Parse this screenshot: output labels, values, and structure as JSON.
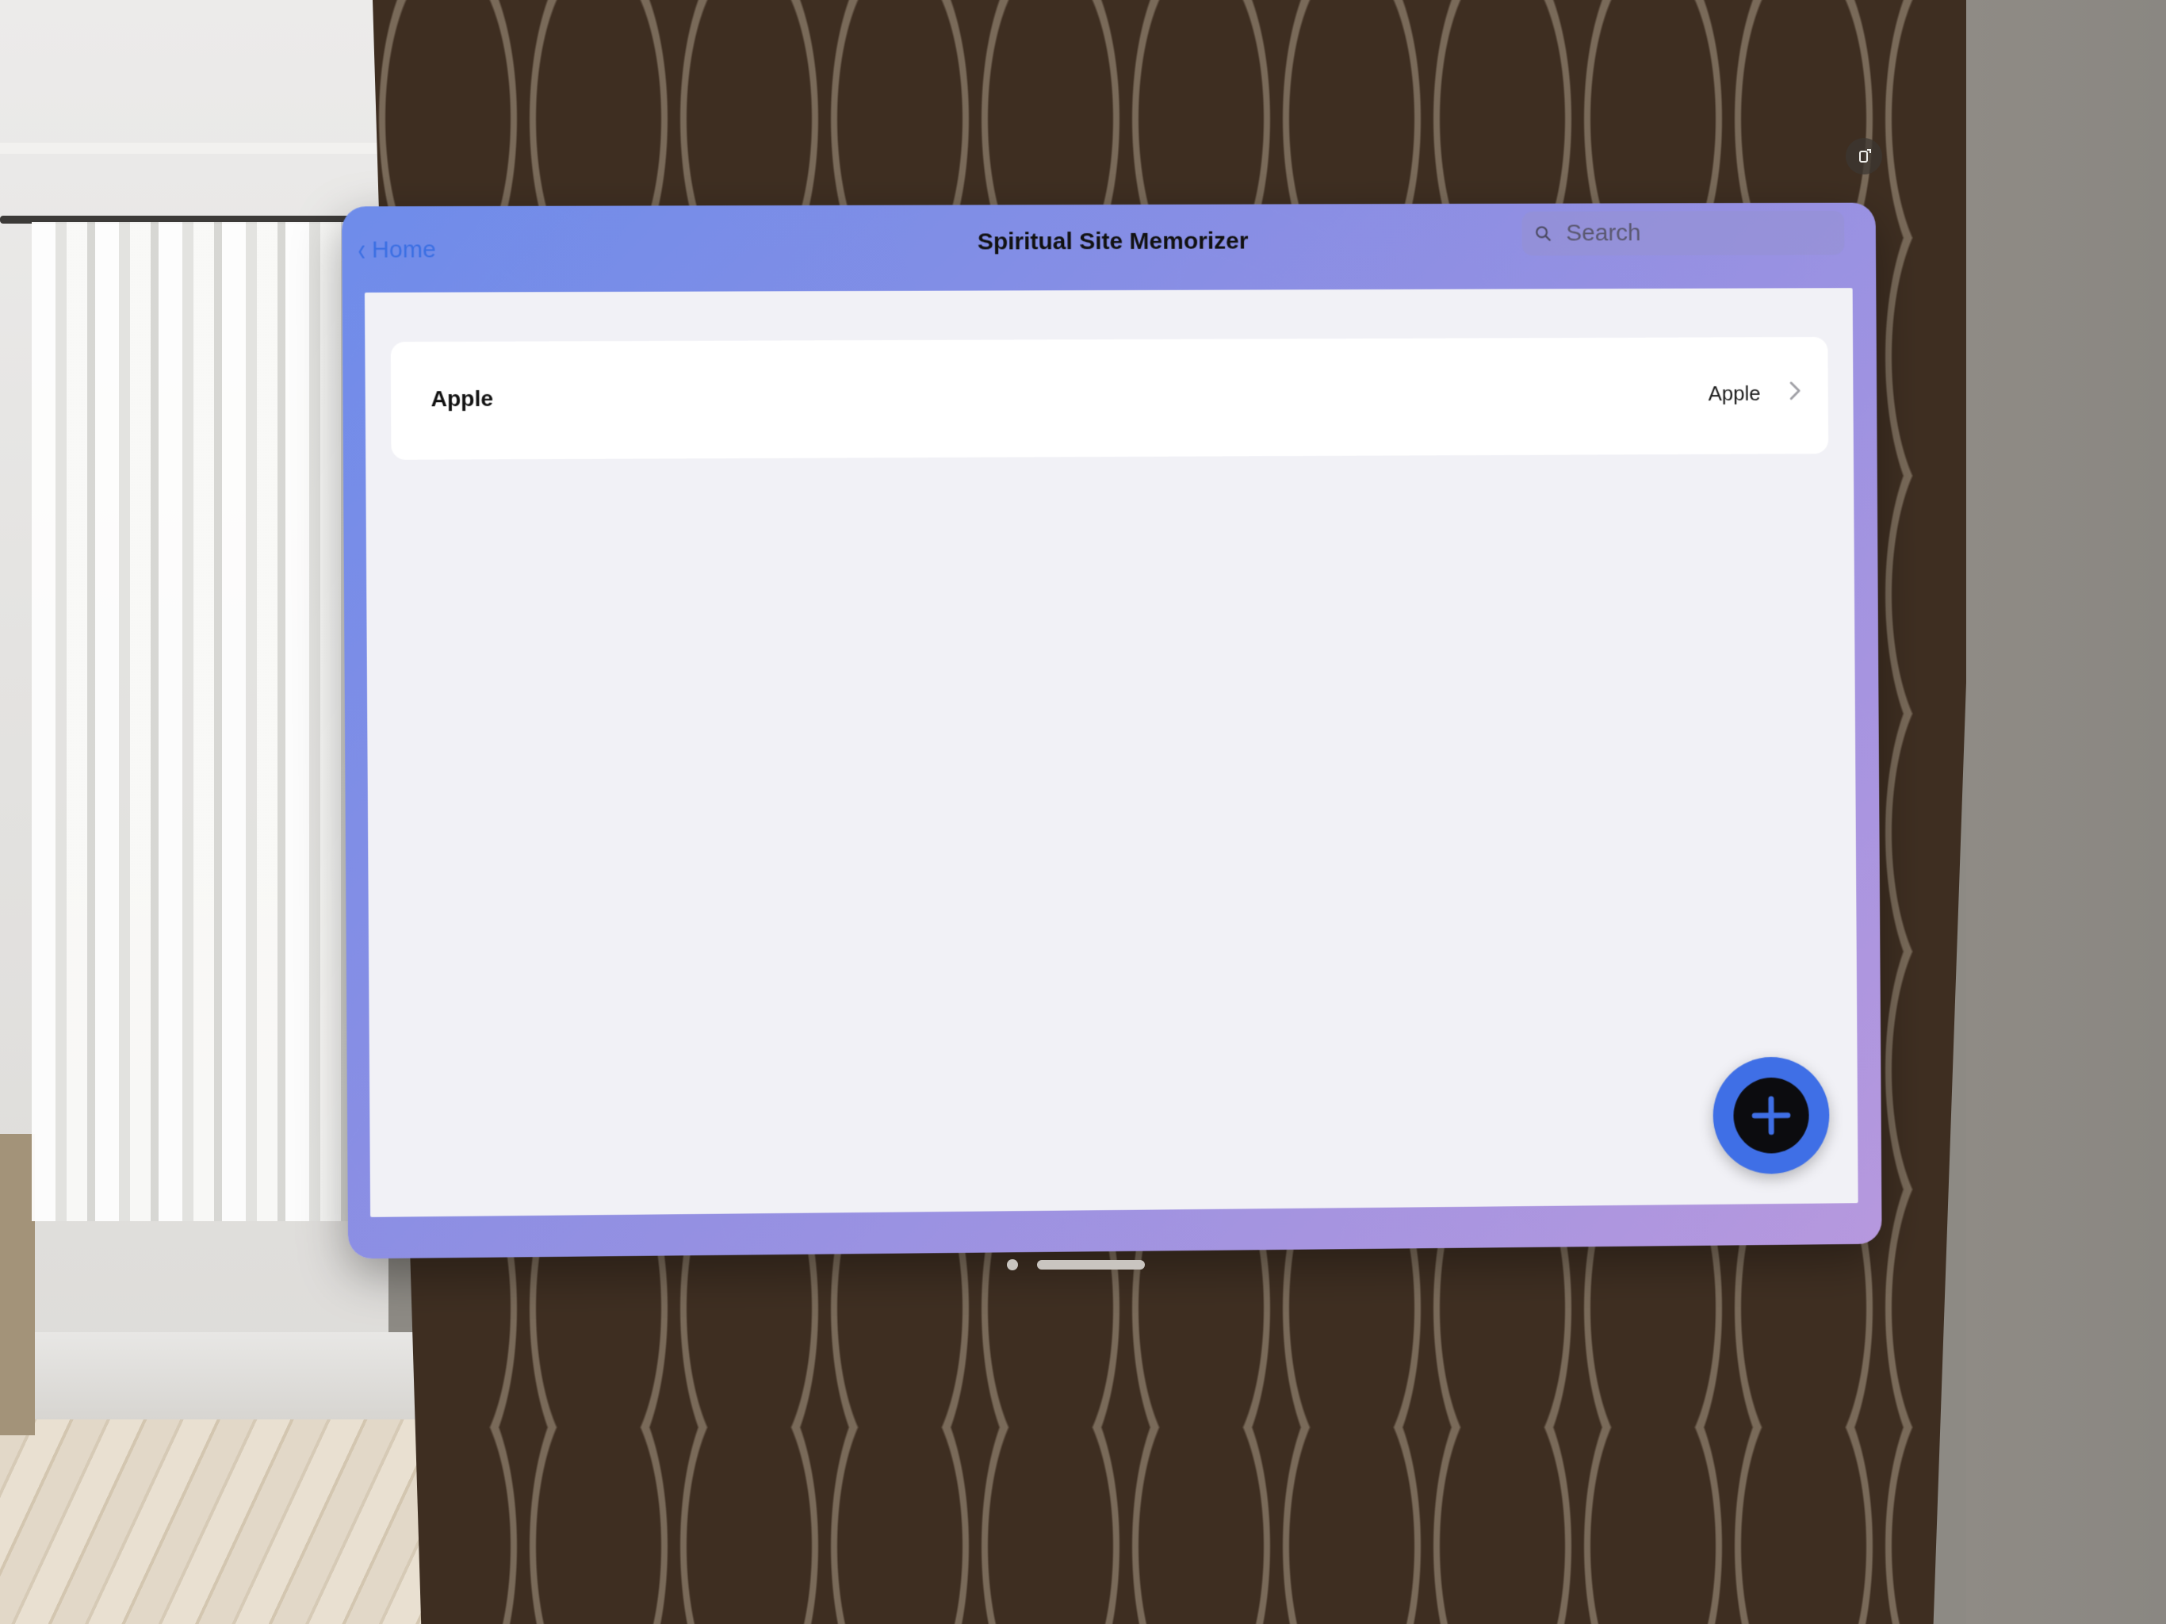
{
  "window": {
    "title": "Spiritual Site Memorizer",
    "back_label": "Home",
    "search": {
      "placeholder": "Search",
      "value": ""
    }
  },
  "list": {
    "items": [
      {
        "label": "Apple",
        "detail": "Apple"
      }
    ]
  },
  "icons": {
    "back": "chevron-left-icon",
    "search": "magnifying-glass-icon",
    "disclosure": "chevron-right-icon",
    "add": "plus-icon",
    "ornament": "resize-icon"
  },
  "colors": {
    "accent": "#3f6fe6",
    "window_gradient_start": "#6e8cea",
    "window_gradient_end": "#b698de",
    "content_background": "#f1f1f6"
  }
}
